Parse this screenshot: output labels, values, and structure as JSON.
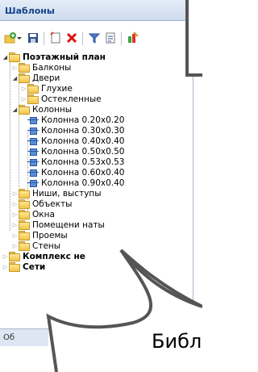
{
  "panel": {
    "title": "Шаблоны"
  },
  "toolbar": {
    "icons": [
      "add-folder-icon",
      "save-icon",
      "new-template-icon",
      "delete-icon",
      "filter-icon",
      "export-icon",
      "properties-icon"
    ]
  },
  "tree": {
    "root": "Поэтажный план",
    "balkony": "Балконы",
    "dveri": "Двери",
    "glukhie": "Глухие",
    "osteklennye": "Остекленные",
    "kolonny": "Колонны",
    "columns": [
      "Колонна 0.20x0.20",
      "Колонна 0.30x0.30",
      "Колонна 0.40x0.40",
      "Колонна 0.50x0.50",
      "Колонна 0.53x0.53",
      "Колонна 0.60x0.40",
      "Колонна 0.90x0.40"
    ],
    "nishi": "Ниши, выступы",
    "obekty": "Объекты",
    "okna": "Окна",
    "pomeshcheniya": "Помещени    наты",
    "proemy": "Проемы",
    "steny": "Стены",
    "kompleks": "Комплекс не",
    "seti": "Сети"
  },
  "status": {
    "text": "Об"
  },
  "callout": {
    "text": "Библ"
  }
}
